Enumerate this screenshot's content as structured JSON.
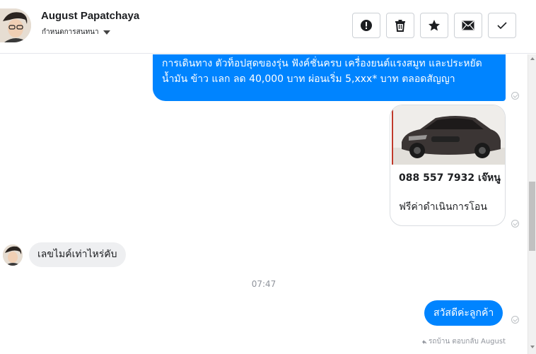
{
  "header": {
    "contact_name": "August Papatchaya",
    "subtitle": "กำหนดการสนทนา",
    "actions": [
      {
        "icon": "alert-icon",
        "label": "report"
      },
      {
        "icon": "trash-icon",
        "label": "delete"
      },
      {
        "icon": "star-icon",
        "label": "star"
      },
      {
        "icon": "envelope-icon",
        "label": "mark-unread"
      },
      {
        "icon": "check-icon",
        "label": "done"
      }
    ]
  },
  "messages": {
    "outgoing_long": "การเดินทาง ตัวท็อปสุดของรุ่น ฟังค์ชั่นครบ เครื่องยนต์แรงสมูท และประหยัดน้ำมัน ข้าว แลก ลด 40,000 บาท ผ่อนเริ่ม 5,xxx* บาท ตลอดสัญญา",
    "card_phone": "088 557 7932 เจ๊หนู",
    "card_text": "ฟรีค่าดำเนินการโอน",
    "incoming": "เลขไมค์เท่าไหร่คับ",
    "timestamp": "07:47",
    "outgoing_short": "สวัสดีค่ะลูกค้า",
    "reply_note": "รถบ้าน ตอบกลับ August"
  },
  "colors": {
    "outgoing_bubble": "#0084ff",
    "incoming_bubble": "#eeeff1"
  }
}
